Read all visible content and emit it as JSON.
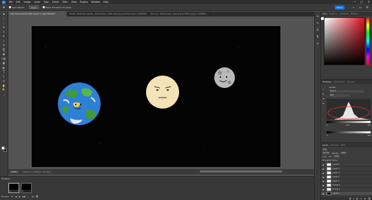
{
  "menubar": {
    "logo": "Ps",
    "items": [
      "File",
      "Edit",
      "Image",
      "Layer",
      "Type",
      "Select",
      "Filter",
      "View",
      "Plugins",
      "Window",
      "Help"
    ],
    "window_controls": [
      "—",
      "□",
      "✕"
    ]
  },
  "options": {
    "auto_select_label": "Auto-Select:",
    "auto_select_value": "Layer",
    "show_transform_label": "Show Transform Controls",
    "share_label": "Share"
  },
  "tabs": [
    {
      "label": "Start Scene.psd @ 100% (Layer 1, Layer Mask/8) *",
      "active": true
    },
    {
      "label": "Planet - Stationary Sprites - Earth Golden - RGB, 16px.png @ 100% (Layer 1, RGB/8#)",
      "active": false
    },
    {
      "label": "Mercury - Fault Golden - 16px.png @ 100% (Layer 1, RGB/8#)",
      "active": false
    }
  ],
  "tools": [
    "✥",
    "⬚",
    "◌",
    "⌖",
    "✂",
    "✒",
    "⌁",
    "✎",
    "⎘",
    "◉",
    "⌫",
    "▦",
    "◐",
    "T",
    "↖",
    "▭",
    "✋",
    "🔍",
    "…"
  ],
  "canvas": {
    "background": "#030303",
    "earth": {
      "ocean": "#2e7fd6",
      "land": "#3f9a3a"
    },
    "sun": {
      "fill": "#f4e3b6"
    },
    "moon": {
      "fill": "#b9b9b9"
    }
  },
  "status": {
    "zoom": "100%",
    "doc_info": "1920 px x 1080 px (72 ppi)"
  },
  "timeline": {
    "title": "Timeline",
    "frames": [
      {
        "num": "1",
        "duration": "0 sec.",
        "selected": true
      },
      {
        "num": "2",
        "duration": "0 sec.",
        "selected": false
      }
    ],
    "loop_label": "Forever"
  },
  "panels": {
    "color_tabs": [
      "Color",
      "Swatches",
      "Gradients",
      "Patterns"
    ],
    "properties_tabs": [
      "Properties",
      "Adjustments",
      "Libraries"
    ],
    "levels_title": "Levels",
    "preset_value": "Custom",
    "channel_value": "RGB",
    "input_values": [
      "0",
      "1.00",
      "255"
    ],
    "output_values": [
      "0",
      "255"
    ],
    "layers_tabs": [
      "Layers",
      "Channels",
      "Paths"
    ],
    "kind_label": "Kind",
    "blend_mode": "Normal",
    "opacity_label": "Opacity:",
    "opacity_value": "100%",
    "lock_label": "Lock:",
    "fill_label": "Fill:",
    "fill_value": "100%",
    "propagate_label": "Propagate Frame 1",
    "layers": [
      {
        "name": "Layer 5",
        "thumb": "white",
        "active": false
      },
      {
        "name": "Layer 4",
        "thumb": "white",
        "active": false
      },
      {
        "name": "Layer 3",
        "thumb": "white",
        "active": false
      },
      {
        "name": "Layer 2",
        "thumb": "white",
        "active": false
      },
      {
        "name": "Layer 1",
        "thumb": "white",
        "active": false
      },
      {
        "name": "Frame 2",
        "thumb": "white",
        "active": false
      },
      {
        "name": "Frame 1",
        "thumb": "white",
        "active": false
      },
      {
        "name": "Layer 1",
        "thumb": "black",
        "active": true
      }
    ]
  }
}
